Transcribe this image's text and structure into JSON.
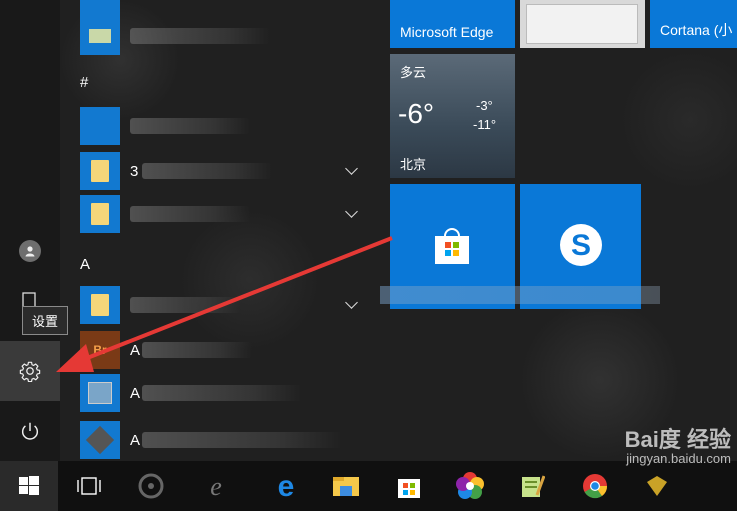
{
  "rail": {
    "tooltip": "设置",
    "icons": [
      "user-icon",
      "documents-icon",
      "gear-icon",
      "power-icon"
    ]
  },
  "applist": {
    "section_hash": "#",
    "section_a": "A",
    "row_prefixes": [
      "3",
      "A",
      "A",
      "A"
    ]
  },
  "tiles": {
    "edge": "Microsoft Edge",
    "cortana": "Cortana (小",
    "weather": {
      "condition": "多云",
      "temp": "-6°",
      "high": "-3°",
      "low": "-11°",
      "city": "北京"
    }
  },
  "taskbar": {
    "icons": [
      "windows-start-icon",
      "task-view-icon",
      "fan-app-icon",
      "ie-icon",
      "edge-icon",
      "file-explorer-icon",
      "store-icon",
      "picasa-icon",
      "notepad-plus-icon",
      "chrome-icon",
      "misc-app-icon"
    ]
  },
  "watermark": {
    "line1": "Bai度 经验",
    "line2": "jingyan.baidu.com"
  },
  "colors": {
    "accent": "#0a78d7",
    "folder": "#f4d67a",
    "arrow": "#e53935"
  }
}
